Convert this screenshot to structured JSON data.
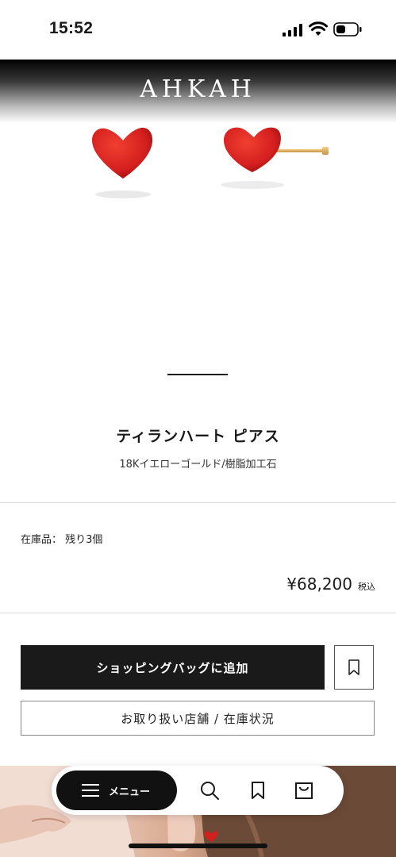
{
  "status_bar": {
    "time": "15:52"
  },
  "brand": {
    "name": "AHKAH"
  },
  "product": {
    "name": "ティランハート ピアス",
    "material": "18Kイエローゴールド/樹脂加工石",
    "stock": "在庫品： 残り3個",
    "price": "¥68,200",
    "tax_label": "税込"
  },
  "actions": {
    "add_to_bag": "ショッピングバッグに追加",
    "store_stock": "お取り扱い店舗 / 在庫状況"
  },
  "bottom_nav": {
    "menu_label": "メニュー",
    "icons": [
      "menu-icon",
      "search-icon",
      "bookmark-icon",
      "bag-icon"
    ]
  },
  "colors": {
    "accent_dark": "#1a1a1a",
    "heart_red": "#d41f1f",
    "gold": "#d9a84e"
  }
}
